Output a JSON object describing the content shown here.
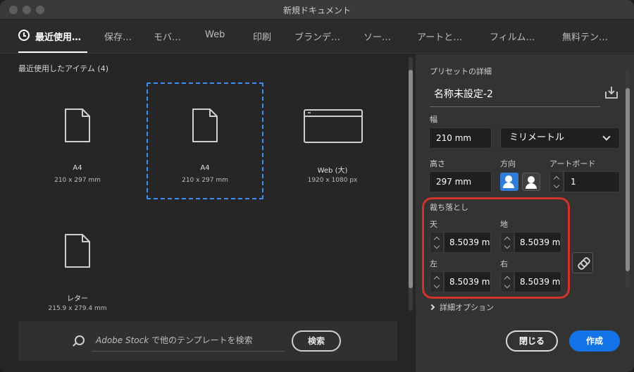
{
  "window": {
    "title": "新規ドキュメント"
  },
  "tabs": [
    {
      "label": "最近使用…",
      "active": true
    },
    {
      "label": "保存…"
    },
    {
      "label": "モバ…"
    },
    {
      "label": "Web"
    },
    {
      "label": "印刷"
    },
    {
      "label": "ブランデ…"
    },
    {
      "label": "ソー…"
    },
    {
      "label": "アートと…"
    },
    {
      "label": "フィルム…"
    },
    {
      "label": "無料テン…"
    }
  ],
  "recent": {
    "title": "最近使用したアイテム",
    "count": "(4)",
    "items": [
      {
        "name": "A4",
        "size": "210 x 297 mm",
        "icon": "document-icon"
      },
      {
        "name": "A4",
        "size": "210 x 297 mm",
        "icon": "document-icon",
        "selected": true
      },
      {
        "name": "Web (大)",
        "size": "1920 x 1080 px",
        "icon": "browser-window-icon"
      },
      {
        "name": "レター",
        "size": "215.9 x 279.4 mm",
        "icon": "document-icon"
      }
    ]
  },
  "search": {
    "brand": "Adobe Stock",
    "placeholder": "で他のテンプレートを検索",
    "button": "検索"
  },
  "preset": {
    "section_label": "プリセットの詳細",
    "name": "名称未設定-2",
    "width_label": "幅",
    "width_value": "210 mm",
    "unit": "ミリメートル",
    "height_label": "高さ",
    "height_value": "297 mm",
    "orientation_label": "方向",
    "orientation": "portrait",
    "artboard_label": "アートボード",
    "artboard_value": "1",
    "bleed_label": "裁ち落とし",
    "bleed": {
      "top_label": "天",
      "top": "8.5039 m",
      "bottom_label": "地",
      "bottom": "8.5039 m",
      "left_label": "左",
      "left": "8.5039 m",
      "right_label": "右",
      "right": "8.5039 m"
    },
    "advanced": "詳細オプション"
  },
  "footer": {
    "close": "閉じる",
    "create": "作成"
  },
  "colors": {
    "accent": "#1473e6",
    "highlight": "#d2332a",
    "selection": "#3d8ef0"
  }
}
